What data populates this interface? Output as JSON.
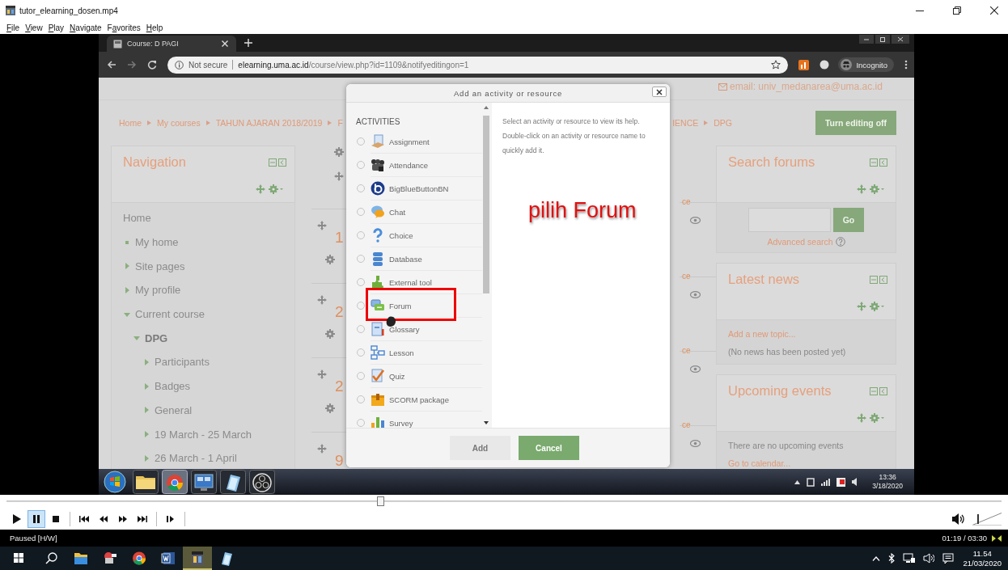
{
  "window": {
    "title": "tutor_elearning_dosen.mp4"
  },
  "menu": [
    {
      "key": "F",
      "rest": "ile"
    },
    {
      "key": "V",
      "rest": "iew"
    },
    {
      "key": "P",
      "rest": "lay"
    },
    {
      "key": "N",
      "rest": "avigate"
    },
    {
      "pre": "F",
      "key": "a",
      "rest": "vorites"
    },
    {
      "key": "H",
      "rest": "elp"
    }
  ],
  "browser": {
    "tab": "Course: D PAGI",
    "security": "Not secure",
    "host": "elearning.uma.ac.id",
    "path": "/course/view.php?id=1109&notifyeditingon=1",
    "profile": "Incognito"
  },
  "page": {
    "email": "email: univ_medanarea@uma.ac.id",
    "breadcrumb_left": [
      "Home",
      "My courses",
      "TAHUN AJARAN 2018/2019",
      "F"
    ],
    "breadcrumb_right": [
      "IENCE",
      "DPG"
    ],
    "edit_button": "Turn editing off",
    "navigation": {
      "title": "Navigation",
      "items": [
        {
          "label": "Home",
          "kind": "plain"
        },
        {
          "label": "My home",
          "kind": "leaf"
        },
        {
          "label": "Site pages",
          "kind": "branch",
          "expanded": false
        },
        {
          "label": "My profile",
          "kind": "branch",
          "expanded": false
        },
        {
          "label": "Current course",
          "kind": "branch",
          "expanded": true,
          "children": [
            {
              "label": "DPG",
              "kind": "course",
              "expanded": true,
              "children": [
                {
                  "label": "Participants",
                  "kind": "branch",
                  "expanded": false
                },
                {
                  "label": "Badges",
                  "kind": "branch",
                  "expanded": false
                },
                {
                  "label": "General",
                  "kind": "branch",
                  "expanded": false
                },
                {
                  "label": "19 March - 25 March",
                  "kind": "branch",
                  "expanded": false
                },
                {
                  "label": "26 March - 1 April",
                  "kind": "branch",
                  "expanded": false
                }
              ]
            }
          ]
        }
      ]
    },
    "sections": [
      {
        "number": "1",
        "tail": "ce"
      },
      {
        "number": "2",
        "tail": "ce"
      },
      {
        "number": "2",
        "tail": "ce"
      },
      {
        "number": "9",
        "tail": "ce"
      }
    ],
    "blocks": [
      {
        "kind": "search",
        "title": "Search forums",
        "button": "Go",
        "link": "Advanced search"
      },
      {
        "kind": "news",
        "title": "Latest news",
        "link": "Add a new topic...",
        "text": "(No news has been posted yet)"
      },
      {
        "kind": "events",
        "title": "Upcoming events",
        "text": "There are no upcoming events",
        "link": "Go to calendar..."
      }
    ]
  },
  "dialog": {
    "title": "Add an activity or resource",
    "heading": "ACTIVITIES",
    "items": [
      {
        "label": "Assignment",
        "kind": "assignment",
        "selected": false,
        "highlighted": false
      },
      {
        "label": "Attendance",
        "kind": "attendance",
        "selected": false,
        "highlighted": false
      },
      {
        "label": "BigBlueButtonBN",
        "kind": "bigbluebutton",
        "selected": false,
        "highlighted": false
      },
      {
        "label": "Chat",
        "kind": "chat",
        "selected": false,
        "highlighted": false
      },
      {
        "label": "Choice",
        "kind": "choice",
        "selected": false,
        "highlighted": false
      },
      {
        "label": "Database",
        "kind": "database",
        "selected": false,
        "highlighted": false
      },
      {
        "label": "External tool",
        "kind": "tool",
        "selected": false,
        "highlighted": false
      },
      {
        "label": "Forum",
        "kind": "forum",
        "selected": false,
        "highlighted": true
      },
      {
        "label": "Glossary",
        "kind": "glossary",
        "selected": false,
        "highlighted": false
      },
      {
        "label": "Lesson",
        "kind": "lesson",
        "selected": false,
        "highlighted": false
      },
      {
        "label": "Quiz",
        "kind": "quiz",
        "selected": false,
        "highlighted": false
      },
      {
        "label": "SCORM package",
        "kind": "scorm",
        "selected": false,
        "highlighted": false
      },
      {
        "label": "Survey",
        "kind": "survey",
        "selected": false,
        "highlighted": false
      }
    ],
    "help": "Select an activity or resource to view its help. Double-click on an activity or resource name to quickly add it.",
    "annotation": "pilih Forum",
    "buttons": [
      {
        "label": "Add",
        "kind": "default"
      },
      {
        "label": "Cancel",
        "kind": "primary"
      }
    ]
  },
  "taskbar7": {
    "apps": [
      {
        "kind": "explorer",
        "active": false
      },
      {
        "kind": "chrome",
        "active": true
      },
      {
        "kind": "remote",
        "active": false
      },
      {
        "kind": "notes",
        "active": false
      },
      {
        "kind": "obs",
        "active": false
      }
    ],
    "time": "13:36",
    "date": "3/18/2020"
  },
  "player": {
    "seek": {
      "level": 0.376
    },
    "controls": [
      {
        "kind": "play",
        "selected": false
      },
      {
        "kind": "pause",
        "selected": true
      },
      {
        "kind": "stop",
        "selected": false
      },
      {
        "kind": "prev",
        "selected": false
      },
      {
        "kind": "rewind",
        "selected": false
      },
      {
        "kind": "forward",
        "selected": false
      },
      {
        "kind": "next",
        "selected": false
      },
      {
        "kind": "step",
        "selected": false
      }
    ],
    "volume": {
      "level": 0.2
    },
    "state": "Paused [H/W]",
    "time": "01:19 / 03:30"
  },
  "taskbar": {
    "apps": [
      {
        "kind": "explorer",
        "active": false
      },
      {
        "kind": "tool",
        "active": false
      },
      {
        "kind": "chrome",
        "active": false
      },
      {
        "kind": "word",
        "active": false
      },
      {
        "kind": "player",
        "active": true
      },
      {
        "kind": "notes",
        "active": false
      }
    ],
    "time": "11.54",
    "date": "21/03/2020"
  }
}
